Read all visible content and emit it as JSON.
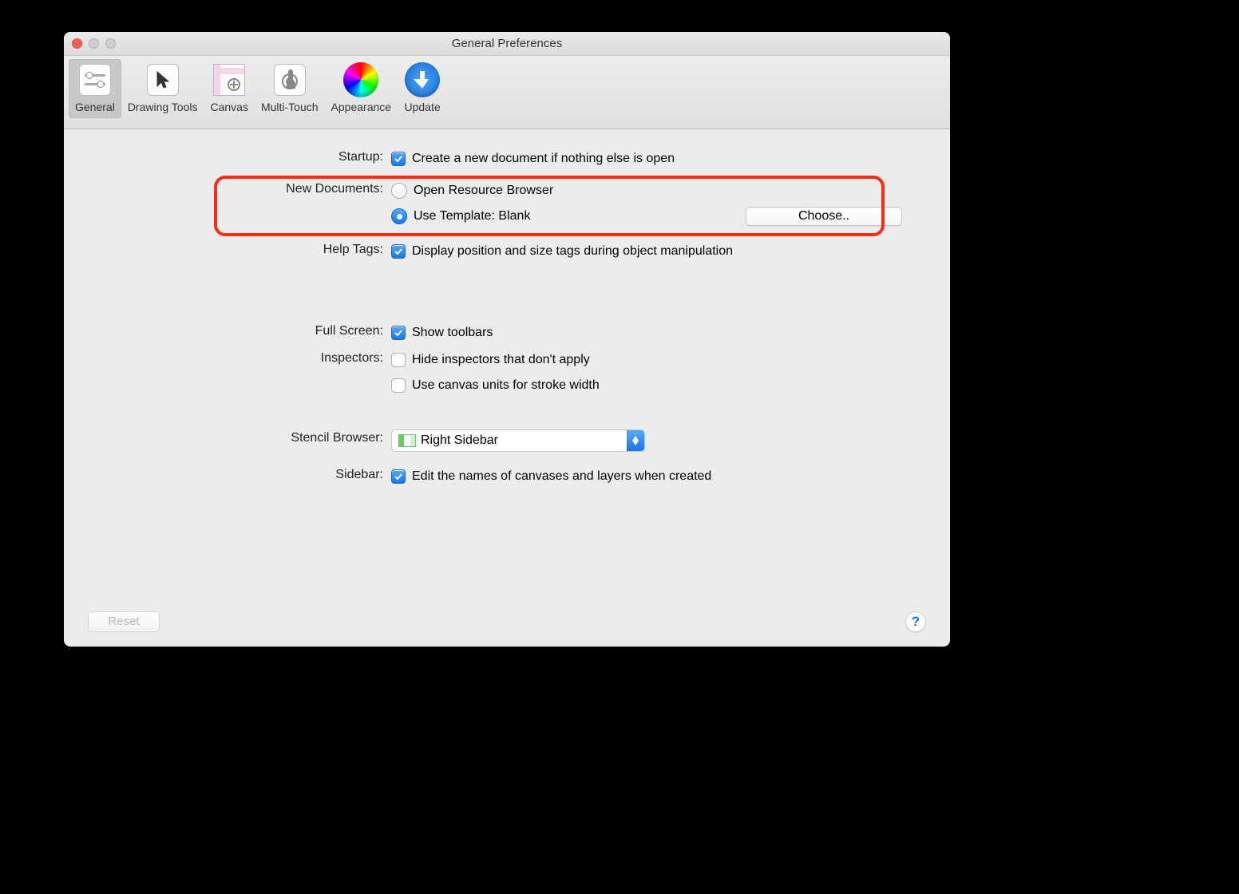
{
  "window": {
    "title": "General Preferences"
  },
  "toolbar": {
    "tabs": [
      {
        "label": "General",
        "icon": "sliders-icon",
        "selected": true
      },
      {
        "label": "Drawing Tools",
        "icon": "cursor-icon",
        "selected": false
      },
      {
        "label": "Canvas",
        "icon": "canvas-icon",
        "selected": false
      },
      {
        "label": "Multi-Touch",
        "icon": "touch-icon",
        "selected": false
      },
      {
        "label": "Appearance",
        "icon": "colorwheel-icon",
        "selected": false
      },
      {
        "label": "Update",
        "icon": "download-icon",
        "selected": false
      }
    ]
  },
  "sections": {
    "startup": {
      "label": "Startup:",
      "create_new_doc": {
        "text": "Create a new document if nothing else is open",
        "checked": true
      }
    },
    "new_documents": {
      "label": "New Documents:",
      "open_resource_browser": {
        "text": "Open Resource Browser",
        "selected": false
      },
      "use_template": {
        "text": "Use Template: Blank",
        "selected": true
      },
      "choose_button": "Choose.."
    },
    "help_tags": {
      "label": "Help Tags:",
      "display_pos_size": {
        "text": "Display position and size tags during object manipulation",
        "checked": true
      }
    },
    "full_screen": {
      "label": "Full Screen:",
      "show_toolbars": {
        "text": "Show toolbars",
        "checked": true
      }
    },
    "inspectors": {
      "label": "Inspectors:",
      "hide_inspectors": {
        "text": "Hide inspectors that don't apply",
        "checked": false
      },
      "canvas_units_stroke": {
        "text": "Use canvas units for stroke width",
        "checked": false
      }
    },
    "stencil_browser": {
      "label": "Stencil Browser:",
      "selected_option": "Right Sidebar"
    },
    "sidebar": {
      "label": "Sidebar:",
      "edit_names": {
        "text": "Edit the names of canvases and layers when created",
        "checked": true
      }
    }
  },
  "footer": {
    "reset": "Reset",
    "help": "?"
  },
  "colors": {
    "accent": "#1877e6",
    "highlight": "#ff2a12"
  }
}
